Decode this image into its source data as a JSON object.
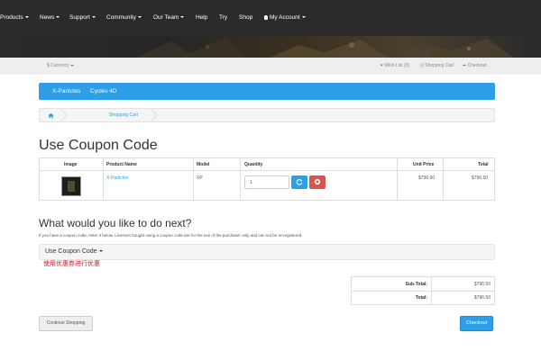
{
  "nav": {
    "items": [
      {
        "label": "Products",
        "dropdown": true
      },
      {
        "label": "News",
        "dropdown": true
      },
      {
        "label": "Support",
        "dropdown": true
      },
      {
        "label": "Community",
        "dropdown": true
      },
      {
        "label": "Our Team",
        "dropdown": true
      },
      {
        "label": "Help",
        "dropdown": false
      },
      {
        "label": "Try",
        "dropdown": false
      },
      {
        "label": "Shop",
        "dropdown": false
      }
    ],
    "account": "My Account"
  },
  "topbar": {
    "currency": "$ Currency",
    "wishlist": "Wish List (0)",
    "cart": "Shopping Cart",
    "checkout": "Checkout"
  },
  "categories": [
    "X-Particles",
    "Cycles 4D"
  ],
  "breadcrumb": {
    "current": "Shopping Cart"
  },
  "page_title": "Use Coupon Code",
  "cart": {
    "headers": {
      "image": "Image",
      "name": "Product Name",
      "model": "Model",
      "quantity": "Quantity",
      "unit_price": "Unit Price",
      "total": "Total"
    },
    "rows": [
      {
        "name": "X-Particles",
        "model": "XP",
        "quantity": "1",
        "unit_price": "$796.50",
        "total": "$796.50"
      }
    ]
  },
  "next": {
    "title": "What would you like to do next?",
    "note": "If you have a coupon code, enter it below. Licenses bought using a coupon code are for the use of the purchaser only and can not be re-registered.",
    "coupon_label": "Use Coupon Code",
    "chinese_note": "使用优惠券进行优惠"
  },
  "totals": {
    "subtotal_label": "Sub-Total:",
    "subtotal_value": "$796.50",
    "total_label": "Total:",
    "total_value": "$796.50"
  },
  "buttons": {
    "continue": "Continue Shopping",
    "checkout": "Checkout"
  },
  "colors": {
    "accent": "#2d9ee8",
    "danger": "#d9534f",
    "navbar": "#2b2b2b",
    "chinese_note": "#e0191e"
  }
}
